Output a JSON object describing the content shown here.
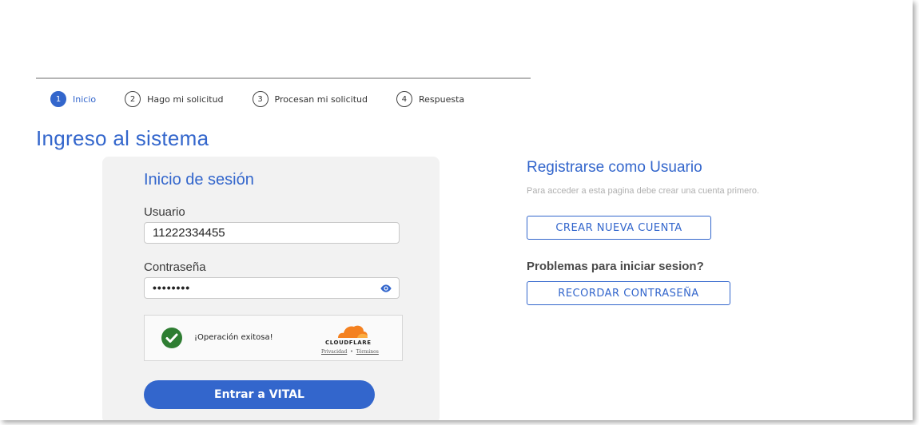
{
  "stepper": {
    "steps": [
      {
        "num": "1",
        "label": "Inicio"
      },
      {
        "num": "2",
        "label": "Hago mi solicitud"
      },
      {
        "num": "3",
        "label": "Procesan mi solicitud"
      },
      {
        "num": "4",
        "label": "Respuesta"
      }
    ],
    "active_step": 1
  },
  "page": {
    "title": "Ingreso al sistema"
  },
  "login": {
    "title": "Inicio de sesión",
    "user_label": "Usuario",
    "user_value": "11222334455",
    "password_label": "Contraseña",
    "password_value": "••••••••",
    "captcha": {
      "status_text": "¡Operación exitosa!",
      "provider": "CLOUDFLARE",
      "privacy_link": "Privacidad",
      "separator": "•",
      "terms_link": "Términos"
    },
    "submit_label": "Entrar a VITAL"
  },
  "register": {
    "title": "Registrarse como Usuario",
    "subtitle": "Para acceder a esta pagina debe crear una cuenta primero.",
    "create_button": "CREAR NUEVA CUENTA",
    "problems_title": "Problemas para iniciar sesion?",
    "recover_button": "RECORDAR CONTRASEÑA"
  },
  "colors": {
    "primary": "#3366cc",
    "card_bg": "#f2f2f2",
    "success": "#2e7d32",
    "cloudflare_orange": "#f48120"
  },
  "icons": {
    "password_toggle": "eye-icon",
    "captcha_status": "check-circle-icon",
    "captcha_logo": "cloudflare-logo-icon"
  }
}
